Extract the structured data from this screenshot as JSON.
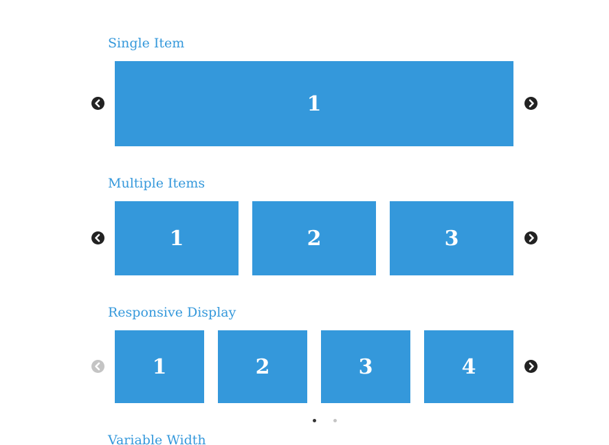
{
  "colors": {
    "accent": "#3498db",
    "arrow_active": "#222222",
    "arrow_disabled": "#c4c4c4"
  },
  "sections": {
    "single": {
      "title": "Single Item",
      "slides": [
        "1"
      ]
    },
    "multiple": {
      "title": "Multiple Items",
      "slides": [
        "1",
        "2",
        "3"
      ]
    },
    "responsive": {
      "title": "Responsive Display",
      "slides": [
        "1",
        "2",
        "3",
        "4"
      ],
      "dots": {
        "count": 2,
        "active_index": 1
      }
    },
    "variable": {
      "title": "Variable Width"
    }
  },
  "icons": {
    "prev": "chevron-left-circle-icon",
    "next": "chevron-right-circle-icon"
  }
}
